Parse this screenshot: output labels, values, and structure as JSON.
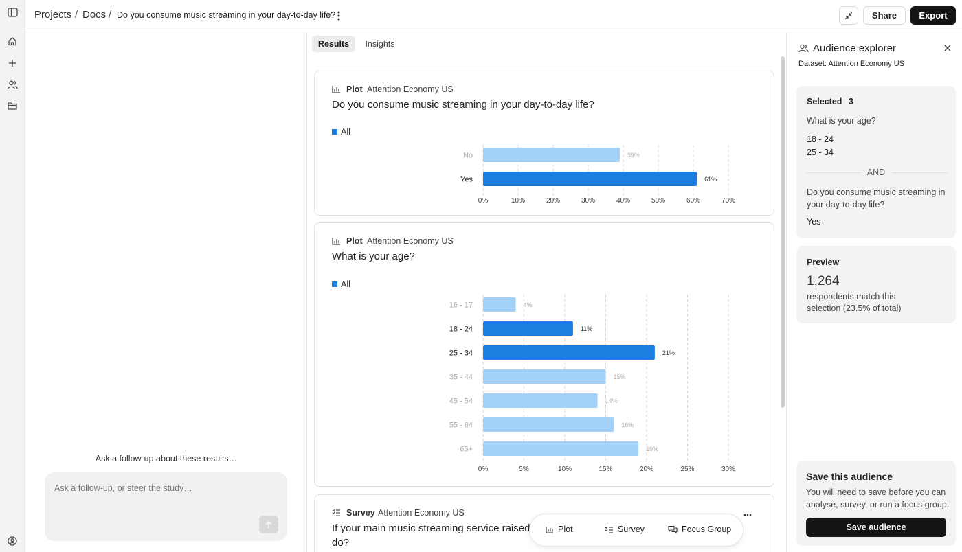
{
  "breadcrumb": {
    "projects": "Projects",
    "docs": "Docs",
    "current": "Do you consume music streaming in your day-to-day life?",
    "separator": "/"
  },
  "toolbar": {
    "share_label": "Share",
    "export_label": "Export"
  },
  "rail": {
    "icons": [
      "sidebar-toggle-icon",
      "home-icon",
      "plus-icon",
      "users-icon",
      "folder-icon",
      "account-icon"
    ]
  },
  "tabs": [
    {
      "label": "Results",
      "active": true
    },
    {
      "label": "Insights",
      "active": false
    }
  ],
  "chat": {
    "prompt": "Ask a follow-up about these results…",
    "placeholder": "Ask a follow-up, or steer the study…"
  },
  "cards": [
    {
      "kind": "Plot",
      "source": "Attention Economy US",
      "title": "Do you consume music streaming in your day-to-day life?",
      "legend": "All"
    },
    {
      "kind": "Plot",
      "source": "Attention Economy US",
      "title": "What is your age?",
      "legend": "All"
    },
    {
      "kind": "Survey",
      "source": "Attention Economy US",
      "title_line1": "If your main music streaming service raised it",
      "title_line2": "do?"
    }
  ],
  "chart_data": [
    {
      "type": "bar",
      "orientation": "horizontal",
      "categories": [
        "No",
        "Yes"
      ],
      "values": [
        39,
        61
      ],
      "value_labels": [
        "39%",
        "61%"
      ],
      "highlighted": [
        false,
        true
      ],
      "xlim": [
        0,
        70
      ],
      "xticks": [
        "0%",
        "10%",
        "20%",
        "30%",
        "40%",
        "50%",
        "60%",
        "70%"
      ],
      "grid": true,
      "legend": "All"
    },
    {
      "type": "bar",
      "orientation": "horizontal",
      "categories": [
        "16 - 17",
        "18 - 24",
        "25 - 34",
        "35 - 44",
        "45 - 54",
        "55 - 64",
        "65+"
      ],
      "values": [
        4,
        11,
        21,
        15,
        14,
        16,
        19
      ],
      "value_labels": [
        "4%",
        "11%",
        "21%",
        "15%",
        "14%",
        "16%",
        "19%"
      ],
      "highlighted": [
        false,
        true,
        true,
        false,
        false,
        false,
        false
      ],
      "xlim": [
        0,
        30
      ],
      "xticks": [
        "0%",
        "5%",
        "10%",
        "15%",
        "20%",
        "25%",
        "30%"
      ],
      "grid": true,
      "legend": "All"
    }
  ],
  "colors": {
    "selected": "#1a7fe0",
    "unselected": "#a3d1f7",
    "dark": "#141414"
  },
  "pill": {
    "plot": "Plot",
    "survey": "Survey",
    "focus_group": "Focus Group"
  },
  "explorer": {
    "title": "Audience explorer",
    "dataset": "Dataset: Attention Economy US",
    "selected_label": "Selected",
    "selected_count": "3",
    "q1": "What is your age?",
    "q1_answers": [
      "18 - 24",
      "25 - 34"
    ],
    "and_label": "AND",
    "q2": "Do you consume music streaming in your day-to-day life?",
    "q2_answer": "Yes",
    "preview_label": "Preview",
    "preview_count": "1,264",
    "preview_text": "respondents match this selection (23.5% of total)",
    "save_title": "Save this audience",
    "save_text": "You will need to save before you can analyse, survey, or run a focus group.",
    "save_button": "Save audience"
  }
}
